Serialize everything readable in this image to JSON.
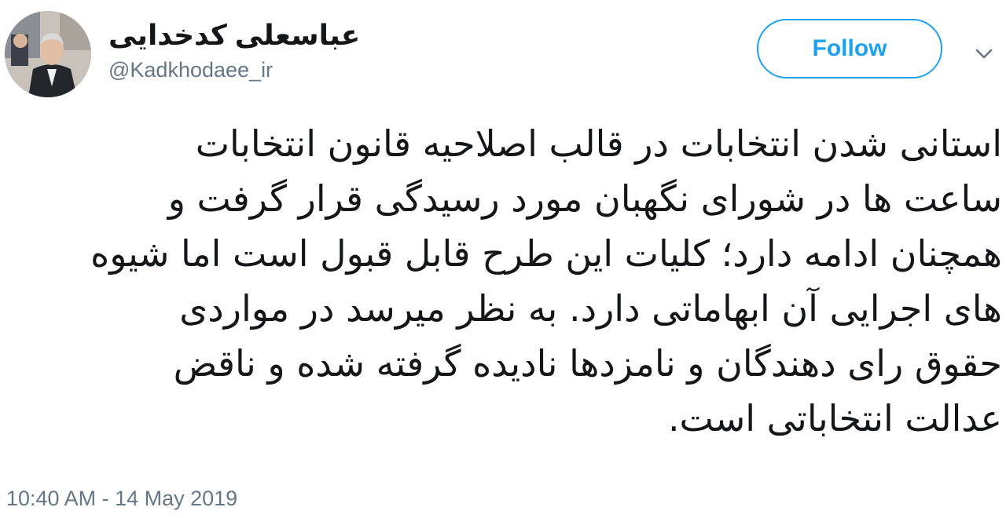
{
  "author": {
    "display_name": "عباسعلی کدخدایی",
    "handle": "@Kadkhodaee_ir"
  },
  "actions": {
    "follow_label": "Follow",
    "more_icon": "chevron-down-icon"
  },
  "tweet": {
    "lines": [
      "استانی شدن انتخابات در قالب اصلاحیه قانون انتخابات",
      "ساعت ها در شورای نگهبان مورد رسیدگی قرار گرفت و",
      "همچنان ادامه دارد؛ کلیات این طرح قابل قبول است اما شیوه",
      "های اجرایی آن ابهاماتی دارد. به نظر میرسد در مواردی",
      "حقوق رای دهندگان و نامزدها نادیده گرفته شده و ناقض",
      "عدالت انتخاباتی است."
    ]
  },
  "meta": {
    "timestamp": "10:40 AM - 14 May 2019"
  },
  "colors": {
    "accent": "#1da1f2",
    "text_primary": "#14171a",
    "text_secondary": "#657786"
  }
}
